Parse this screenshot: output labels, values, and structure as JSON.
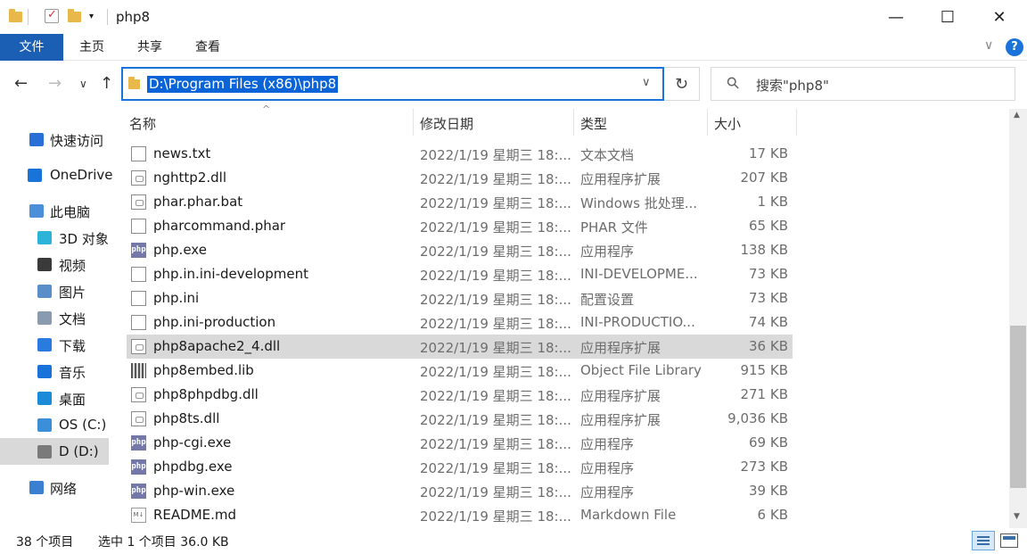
{
  "window": {
    "title": "php8",
    "minimize_glyph": "—",
    "maximize_glyph": "☐",
    "close_glyph": "✕"
  },
  "ribbon": {
    "tabs": [
      "文件",
      "主页",
      "共享",
      "查看"
    ],
    "expand_glyph": "∨",
    "help_glyph": "?"
  },
  "address": {
    "path": "D:\\Program Files (x86)\\php8",
    "dropdown_glyph": "∨",
    "refresh_glyph": "↻"
  },
  "nav": {
    "back": "←",
    "forward": "→",
    "recent": "∨",
    "up": "↑"
  },
  "search": {
    "placeholder": "搜索\"php8\"",
    "icon_glyph": "⚲"
  },
  "sidebar": {
    "items": [
      {
        "label": "快速访问",
        "icon": "star-icon",
        "color": "#2a6fd6"
      },
      {
        "label": "OneDrive",
        "icon": "cloud-icon",
        "color": "#1a73d9"
      },
      {
        "label": "此电脑",
        "icon": "computer-icon",
        "color": "#4a8fd8"
      },
      {
        "label": "3D 对象",
        "icon": "cube-icon",
        "color": "#2bb3d8"
      },
      {
        "label": "视频",
        "icon": "film-icon",
        "color": "#3a3a3a"
      },
      {
        "label": "图片",
        "icon": "picture-icon",
        "color": "#5a8ec8"
      },
      {
        "label": "文档",
        "icon": "document-icon",
        "color": "#8a9bb0"
      },
      {
        "label": "下载",
        "icon": "download-icon",
        "color": "#2a7be0"
      },
      {
        "label": "音乐",
        "icon": "music-icon",
        "color": "#1a73d9"
      },
      {
        "label": "桌面",
        "icon": "desktop-icon",
        "color": "#1a8ad9"
      },
      {
        "label": "OS (C:)",
        "icon": "windows-drive-icon",
        "color": "#3a8fd8"
      },
      {
        "label": "D (D:)",
        "icon": "drive-icon",
        "color": "#7a7a7a"
      },
      {
        "label": "网络",
        "icon": "network-icon",
        "color": "#3a7fd0"
      }
    ]
  },
  "columns": {
    "name": "名称",
    "date": "修改日期",
    "type": "类型",
    "size": "大小",
    "sort_glyph": "^"
  },
  "files": [
    {
      "name": "news.txt",
      "date": "2022/1/19 星期三 18:...",
      "type": "文本文档",
      "size": "17 KB",
      "icon": "text-file-icon"
    },
    {
      "name": "nghttp2.dll",
      "date": "2022/1/19 星期三 18:...",
      "type": "应用程序扩展",
      "size": "207 KB",
      "icon": "dll-icon"
    },
    {
      "name": "phar.phar.bat",
      "date": "2022/1/19 星期三 18:...",
      "type": "Windows 批处理...",
      "size": "1 KB",
      "icon": "bat-icon"
    },
    {
      "name": "pharcommand.phar",
      "date": "2022/1/19 星期三 18:...",
      "type": "PHAR 文件",
      "size": "65 KB",
      "icon": "file-icon"
    },
    {
      "name": "php.exe",
      "date": "2022/1/19 星期三 18:...",
      "type": "应用程序",
      "size": "138 KB",
      "icon": "php-exe-icon"
    },
    {
      "name": "php.in.ini-development",
      "date": "2022/1/19 星期三 18:...",
      "type": "INI-DEVELOPME...",
      "size": "73 KB",
      "icon": "file-icon"
    },
    {
      "name": "php.ini",
      "date": "2022/1/19 星期三 18:...",
      "type": "配置设置",
      "size": "73 KB",
      "icon": "ini-icon"
    },
    {
      "name": "php.ini-production",
      "date": "2022/1/19 星期三 18:...",
      "type": "INI-PRODUCTIO...",
      "size": "74 KB",
      "icon": "file-icon"
    },
    {
      "name": "php8apache2_4.dll",
      "date": "2022/1/19 星期三 18:...",
      "type": "应用程序扩展",
      "size": "36 KB",
      "icon": "dll-icon",
      "selected": true
    },
    {
      "name": "php8embed.lib",
      "date": "2022/1/19 星期三 18:...",
      "type": "Object File Library",
      "size": "915 KB",
      "icon": "lib-icon"
    },
    {
      "name": "php8phpdbg.dll",
      "date": "2022/1/19 星期三 18:...",
      "type": "应用程序扩展",
      "size": "271 KB",
      "icon": "dll-icon"
    },
    {
      "name": "php8ts.dll",
      "date": "2022/1/19 星期三 18:...",
      "type": "应用程序扩展",
      "size": "9,036 KB",
      "icon": "dll-icon"
    },
    {
      "name": "php-cgi.exe",
      "date": "2022/1/19 星期三 18:...",
      "type": "应用程序",
      "size": "69 KB",
      "icon": "php-exe-icon"
    },
    {
      "name": "phpdbg.exe",
      "date": "2022/1/19 星期三 18:...",
      "type": "应用程序",
      "size": "273 KB",
      "icon": "php-exe-icon"
    },
    {
      "name": "php-win.exe",
      "date": "2022/1/19 星期三 18:...",
      "type": "应用程序",
      "size": "39 KB",
      "icon": "php-exe-icon"
    },
    {
      "name": "README.md",
      "date": "2022/1/19 星期三 18:...",
      "type": "Markdown File",
      "size": "6 KB",
      "icon": "markdown-icon"
    }
  ],
  "php_icon_text": "php",
  "md_icon_text": "M↓",
  "status": {
    "count": "38 个项目",
    "selection": "选中 1 个项目 36.0 KB"
  },
  "scroll": {
    "up_glyph": "▲",
    "down_glyph": "▼"
  },
  "colors": {
    "accent": "#1a5fb4",
    "selection": "#d9d9d9",
    "highlight": "#0a64d8"
  }
}
